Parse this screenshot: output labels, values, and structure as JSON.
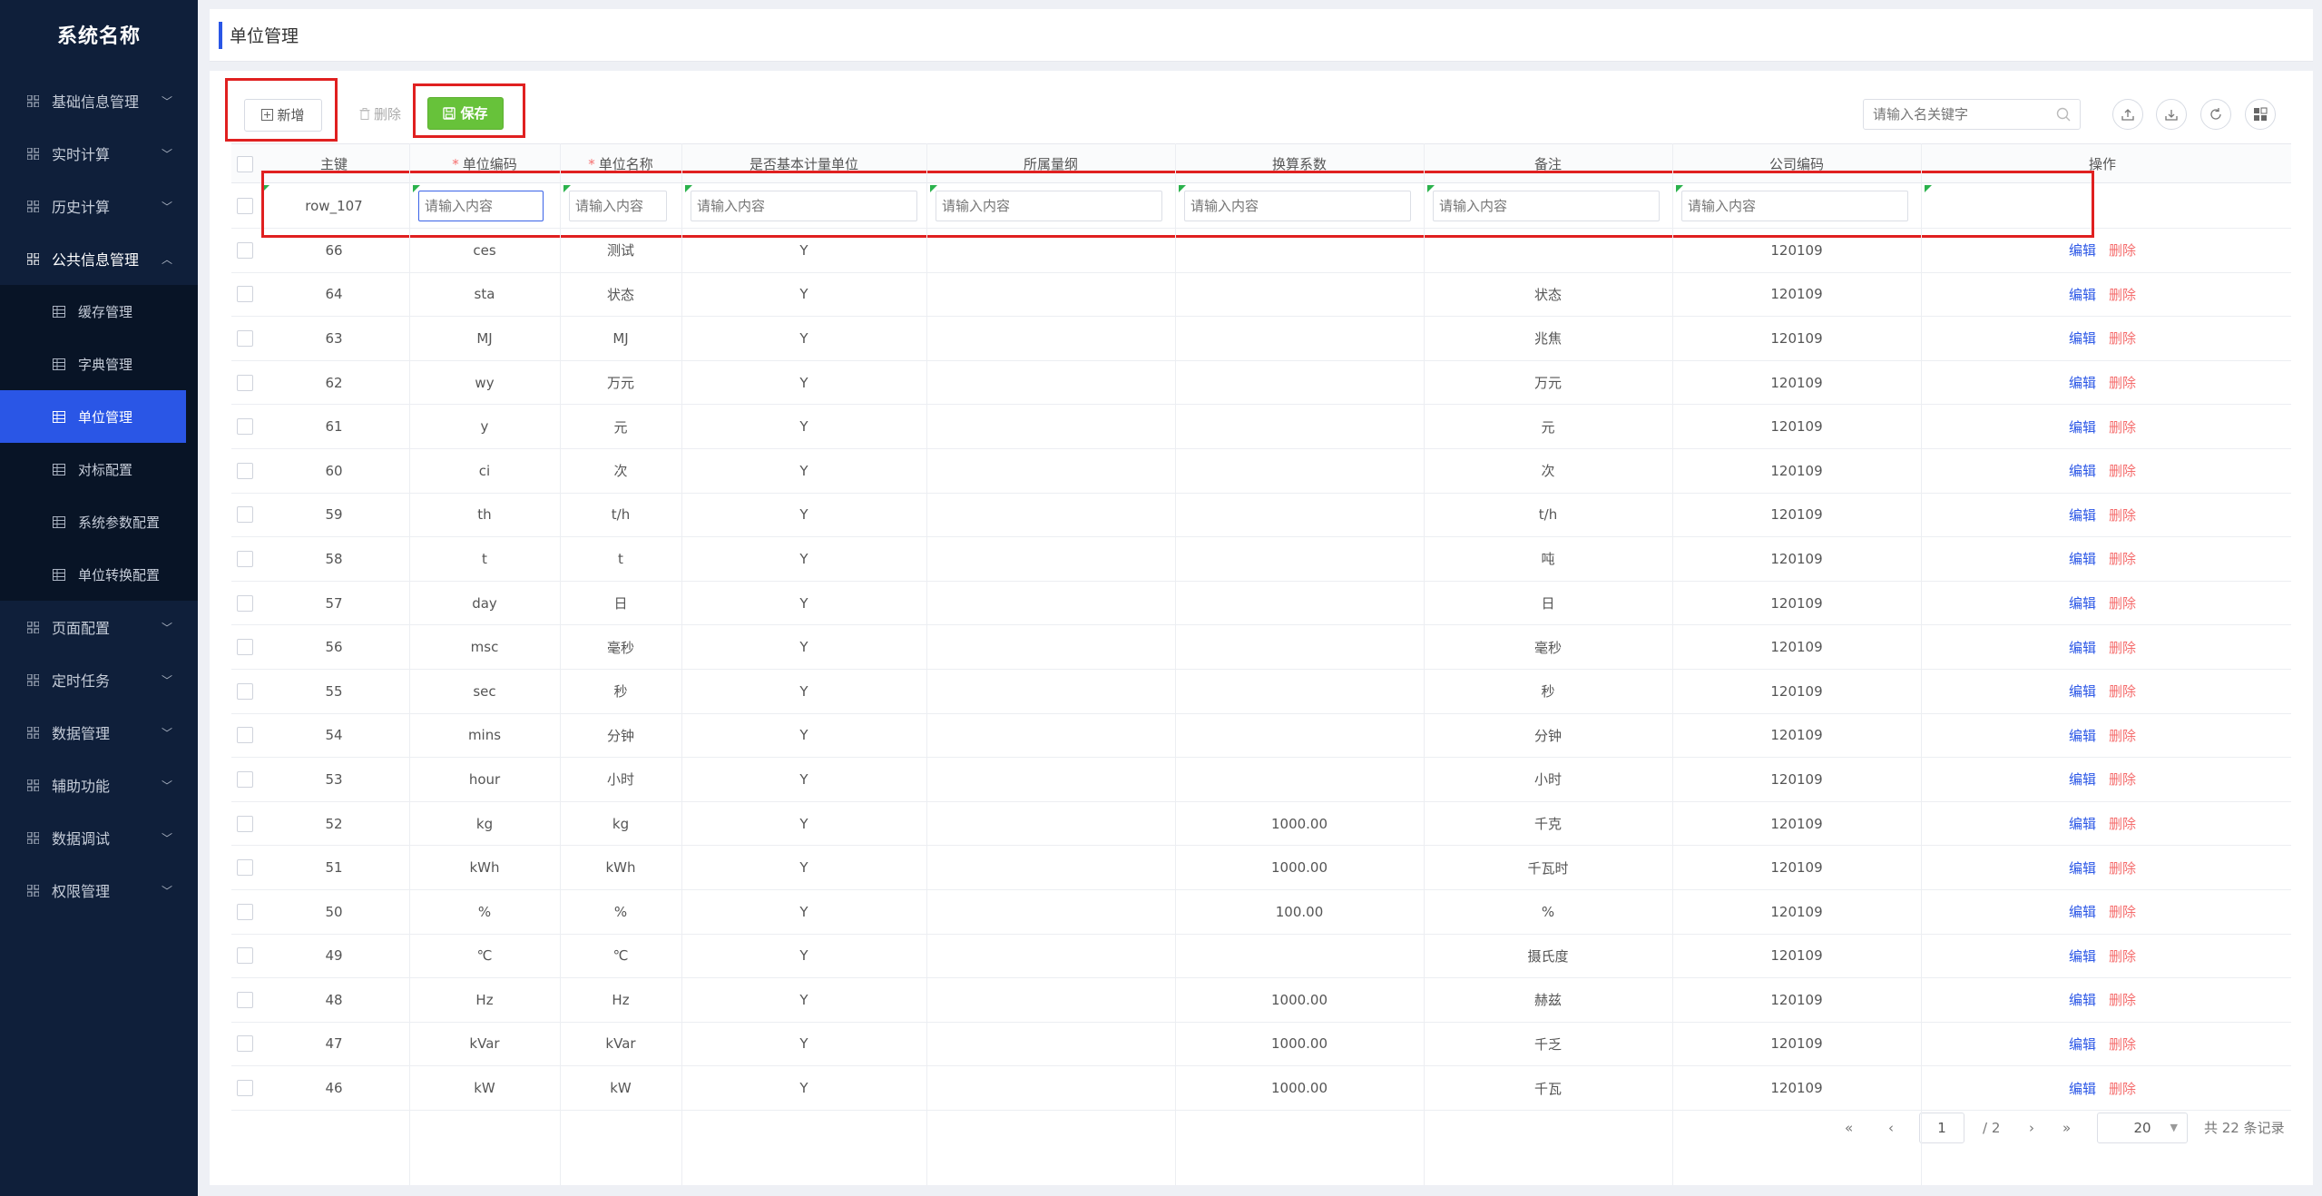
{
  "sidebar": {
    "brand": "系统名称",
    "menu_top": [
      {
        "label": "基础信息管理"
      },
      {
        "label": "实时计算"
      },
      {
        "label": "历史计算"
      }
    ],
    "open_menu": {
      "label": "公共信息管理"
    },
    "submenu": [
      {
        "label": "缓存管理"
      },
      {
        "label": "字典管理"
      },
      {
        "label": "单位管理"
      },
      {
        "label": "对标配置"
      },
      {
        "label": "系统参数配置"
      },
      {
        "label": "单位转换配置"
      }
    ],
    "menu_bottom": [
      {
        "label": "页面配置"
      },
      {
        "label": "定时任务"
      },
      {
        "label": "数据管理"
      },
      {
        "label": "辅助功能"
      },
      {
        "label": "数据调试"
      },
      {
        "label": "权限管理"
      }
    ]
  },
  "header": {
    "title": "单位管理"
  },
  "toolbar": {
    "add_label": "新增",
    "delete_label": "删除",
    "save_label": "保存",
    "search_placeholder": "请输入名关键字"
  },
  "table": {
    "columns": [
      "主键",
      "单位编码",
      "单位名称",
      "是否基本计量单位",
      "所属量纲",
      "换算系数",
      "备注",
      "公司编码",
      "操作"
    ],
    "edit_row": {
      "id": "row_107",
      "placeholder": "请输入内容"
    },
    "rows": [
      {
        "id": "66",
        "code": "ces",
        "name": "测试",
        "base": "Y",
        "dim": "",
        "factor": "",
        "remark": "",
        "company": "120109"
      },
      {
        "id": "64",
        "code": "sta",
        "name": "状态",
        "base": "Y",
        "dim": "",
        "factor": "",
        "remark": "状态",
        "company": "120109"
      },
      {
        "id": "63",
        "code": "MJ",
        "name": "MJ",
        "base": "Y",
        "dim": "",
        "factor": "",
        "remark": "兆焦",
        "company": "120109"
      },
      {
        "id": "62",
        "code": "wy",
        "name": "万元",
        "base": "Y",
        "dim": "",
        "factor": "",
        "remark": "万元",
        "company": "120109"
      },
      {
        "id": "61",
        "code": "y",
        "name": "元",
        "base": "Y",
        "dim": "",
        "factor": "",
        "remark": "元",
        "company": "120109"
      },
      {
        "id": "60",
        "code": "ci",
        "name": "次",
        "base": "Y",
        "dim": "",
        "factor": "",
        "remark": "次",
        "company": "120109"
      },
      {
        "id": "59",
        "code": "th",
        "name": "t/h",
        "base": "Y",
        "dim": "",
        "factor": "",
        "remark": "t/h",
        "company": "120109"
      },
      {
        "id": "58",
        "code": "t",
        "name": "t",
        "base": "Y",
        "dim": "",
        "factor": "",
        "remark": "吨",
        "company": "120109"
      },
      {
        "id": "57",
        "code": "day",
        "name": "日",
        "base": "Y",
        "dim": "",
        "factor": "",
        "remark": "日",
        "company": "120109"
      },
      {
        "id": "56",
        "code": "msc",
        "name": "毫秒",
        "base": "Y",
        "dim": "",
        "factor": "",
        "remark": "毫秒",
        "company": "120109"
      },
      {
        "id": "55",
        "code": "sec",
        "name": "秒",
        "base": "Y",
        "dim": "",
        "factor": "",
        "remark": "秒",
        "company": "120109"
      },
      {
        "id": "54",
        "code": "mins",
        "name": "分钟",
        "base": "Y",
        "dim": "",
        "factor": "",
        "remark": "分钟",
        "company": "120109"
      },
      {
        "id": "53",
        "code": "hour",
        "name": "小时",
        "base": "Y",
        "dim": "",
        "factor": "",
        "remark": "小时",
        "company": "120109"
      },
      {
        "id": "52",
        "code": "kg",
        "name": "kg",
        "base": "Y",
        "dim": "",
        "factor": "1000.00",
        "remark": "千克",
        "company": "120109"
      },
      {
        "id": "51",
        "code": "kWh",
        "name": "kWh",
        "base": "Y",
        "dim": "",
        "factor": "1000.00",
        "remark": "千瓦时",
        "company": "120109"
      },
      {
        "id": "50",
        "code": "%",
        "name": "%",
        "base": "Y",
        "dim": "",
        "factor": "100.00",
        "remark": "%",
        "company": "120109"
      },
      {
        "id": "49",
        "code": "℃",
        "name": "℃",
        "base": "Y",
        "dim": "",
        "factor": "",
        "remark": "摄氏度",
        "company": "120109"
      },
      {
        "id": "48",
        "code": "Hz",
        "name": "Hz",
        "base": "Y",
        "dim": "",
        "factor": "1000.00",
        "remark": "赫兹",
        "company": "120109"
      },
      {
        "id": "47",
        "code": "kVar",
        "name": "kVar",
        "base": "Y",
        "dim": "",
        "factor": "1000.00",
        "remark": "千乏",
        "company": "120109"
      },
      {
        "id": "46",
        "code": "kW",
        "name": "kW",
        "base": "Y",
        "dim": "",
        "factor": "1000.00",
        "remark": "千瓦",
        "company": "120109"
      }
    ],
    "action_edit": "编辑",
    "action_delete": "删除"
  },
  "pagination": {
    "current_page": "1",
    "total_pages": "/ 2",
    "page_size": "20",
    "total_label": "共 22 条记录"
  },
  "colors": {
    "accent": "#2a56e6",
    "save": "#67c23a",
    "danger": "#f56c6c",
    "sidebar": "#0f1f3a"
  }
}
